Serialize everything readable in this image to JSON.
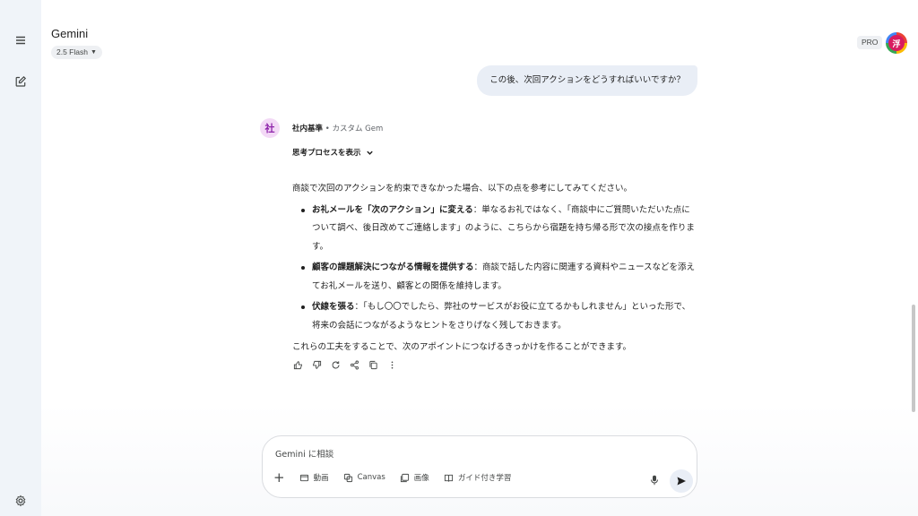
{
  "header": {
    "app_title": "Gemini",
    "model_label": "2.5 Flash",
    "pro_badge": "PRO",
    "avatar_initial": "浮"
  },
  "conversation": {
    "user_message": "この後、次回アクションをどうすればいいですか？",
    "gem": {
      "icon_char": "社",
      "name": "社内基準",
      "separator": " • ",
      "type_label": "カスタム Gem"
    },
    "thinking_toggle": "思考プロセスを表示",
    "response": {
      "intro": "商談で次回のアクションを約束できなかった場合、以下の点を参考にしてみてください。",
      "bullets": [
        {
          "title": "お礼メールを「次のアクション」に変える",
          "text": "：単なるお礼ではなく、「商談中にご質問いただいた点について調べ、後日改めてご連絡します」のように、こちらから宿題を持ち帰る形で次の接点を作ります。"
        },
        {
          "title": "顧客の課題解決につながる情報を提供する",
          "text": "：商談で話した内容に関連する資料やニュースなどを添えてお礼メールを送り、顧客との関係を維持します。"
        },
        {
          "title": "伏線を張る",
          "text": "：「もし〇〇でしたら、弊社のサービスがお役に立てるかもしれません」といった形で、将来の会話につながるようなヒントをさりげなく残しておきます。"
        }
      ],
      "outro": "これらの工夫をすることで、次のアポイントにつなげるきっかけを作ることができます。"
    }
  },
  "input": {
    "placeholder": "Gemini に相談",
    "tools": {
      "video": "動画",
      "canvas": "Canvas",
      "image": "画像",
      "guided": "ガイド付き学習"
    }
  },
  "colors": {
    "sidebar_bg": "#f0f4f9",
    "user_bubble_bg": "#e9eef6",
    "gem_icon_bg": "#f3d9f6",
    "gem_icon_fg": "#8e24aa",
    "avatar_bg": "#d81b60"
  },
  "icons": {
    "sidebar": [
      "menu-icon",
      "new-chat-icon",
      "settings-icon"
    ],
    "response_actions": [
      "thumbs-up-icon",
      "thumbs-down-icon",
      "redo-icon",
      "share-icon",
      "copy-icon",
      "more-vert-icon"
    ]
  }
}
